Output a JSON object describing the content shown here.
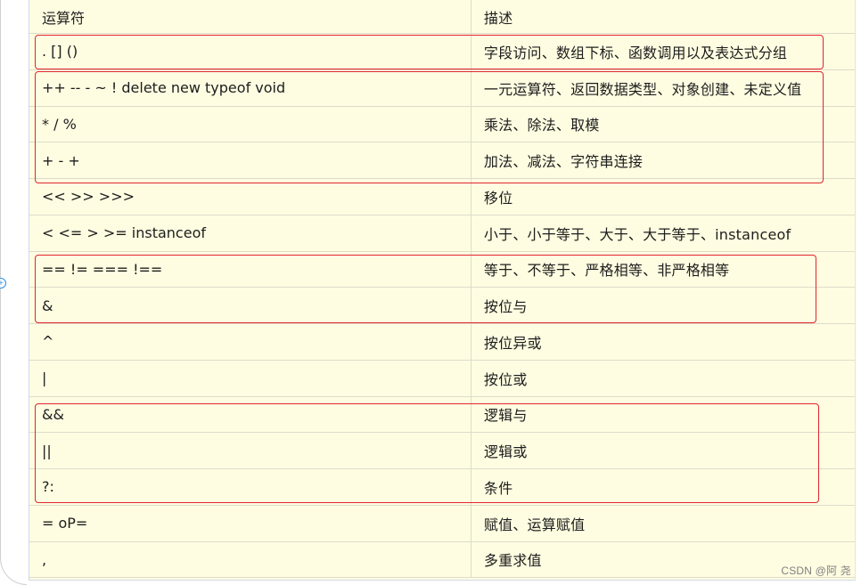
{
  "table": {
    "headers": {
      "operator": "运算符",
      "description": "描述"
    },
    "rows": [
      {
        "operator": ". [] ()",
        "description": "字段访问、数组下标、函数调用以及表达式分组"
      },
      {
        "operator": "++ -- - ~ ! delete new typeof void",
        "description": "一元运算符、返回数据类型、对象创建、未定义值"
      },
      {
        "operator": "* / %",
        "description": "乘法、除法、取模"
      },
      {
        "operator": "+ - +",
        "description": "加法、减法、字符串连接"
      },
      {
        "operator": "<< >> >>>",
        "description": "移位"
      },
      {
        "operator": "< <= > >= instanceof",
        "description": "小于、小于等于、大于、大于等于、instanceof"
      },
      {
        "operator": "== != === !==",
        "description": "等于、不等于、严格相等、非严格相等"
      },
      {
        "operator": "&",
        "description": "按位与"
      },
      {
        "operator": "^",
        "description": "按位异或"
      },
      {
        "operator": "|",
        "description": "按位或"
      },
      {
        "operator": "&&",
        "description": "逻辑与"
      },
      {
        "operator": "||",
        "description": "逻辑或"
      },
      {
        "operator": "?:",
        "description": "条件"
      },
      {
        "operator": "= oP=",
        "description": "赋值、运算赋值"
      },
      {
        "operator": ",",
        "description": "多重求值"
      }
    ]
  },
  "side_marker": {
    "glyph": "+"
  },
  "watermark": {
    "text": "CSDN @阿 尧"
  },
  "colors": {
    "table_background": "#fffde1",
    "highlight_border": "#e0252e",
    "marker": "#2b8ee0"
  }
}
